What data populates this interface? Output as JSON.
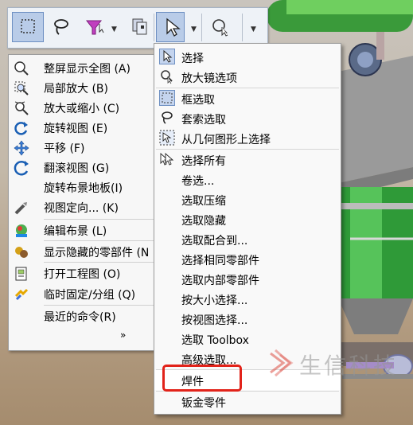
{
  "toolbar": {
    "buttons": [
      {
        "icon": "box-select-icon",
        "active": true
      },
      {
        "icon": "lasso-icon",
        "active": false
      },
      {
        "icon": "filter-select-icon",
        "active": false
      },
      {
        "icon": "select-other-icon",
        "active": false
      },
      {
        "icon": "select-arrow-icon",
        "active": true
      },
      {
        "icon": "magnifier-select-icon",
        "active": false
      }
    ]
  },
  "context_menu": {
    "items": [
      {
        "label": "整屏显示全图 (A)",
        "icon": "zoom-to-fit-icon"
      },
      {
        "label": "局部放大 (B)",
        "icon": "zoom-area-icon"
      },
      {
        "label": "放大或缩小 (C)",
        "icon": "zoom-in-out-icon"
      },
      {
        "label": "旋转视图 (E)",
        "icon": "rotate-view-icon"
      },
      {
        "label": "平移 (F)",
        "icon": "pan-icon"
      },
      {
        "label": "翻滚视图 (G)",
        "icon": "roll-view-icon"
      },
      {
        "label": "旋转布景地板(I)",
        "icon": ""
      },
      {
        "label": "视图定向... (K)",
        "icon": "view-orientation-icon"
      },
      {
        "label": "编辑布景 (L)",
        "icon": "edit-scene-icon"
      },
      {
        "label": "显示隐藏的零部件 (N",
        "icon": "show-hidden-components-icon"
      },
      {
        "label": "打开工程图 (O)",
        "icon": "open-drawing-icon"
      },
      {
        "label": "临时固定/分组 (Q)",
        "icon": "temp-fix-group-icon"
      },
      {
        "label": "最近的命令(R)",
        "icon": ""
      }
    ],
    "more": "»"
  },
  "submenu": {
    "items": [
      {
        "label": "选择",
        "icon": "select-arrow-icon"
      },
      {
        "label": "放大镜选项",
        "icon": "magnifier-select-icon"
      },
      {
        "label": "框选取",
        "icon": "box-select-icon"
      },
      {
        "label": "套索选取",
        "icon": "lasso-icon"
      },
      {
        "label": "从几何图形上选择",
        "icon": "select-over-geometry-icon"
      },
      {
        "label": "选择所有",
        "icon": "select-all-icon"
      },
      {
        "label": "卷选...",
        "icon": ""
      },
      {
        "label": "选取压缩",
        "icon": ""
      },
      {
        "label": "选取隐藏",
        "icon": ""
      },
      {
        "label": "选取配合到...",
        "icon": ""
      },
      {
        "label": "选择相同零部件",
        "icon": ""
      },
      {
        "label": "选取内部零部件",
        "icon": ""
      },
      {
        "label": "按大小选择...",
        "icon": ""
      },
      {
        "label": "按视图选择...",
        "icon": ""
      },
      {
        "label": "选取 Toolbox",
        "icon": ""
      },
      {
        "label": "高级选取...",
        "icon": ""
      },
      {
        "label": "焊件",
        "icon": ""
      },
      {
        "label": "钣金零件",
        "icon": ""
      }
    ]
  },
  "watermark": {
    "text": "生信科技"
  },
  "colors": {
    "highlight_box": "#e2231a",
    "active_button": "#b9cce8"
  }
}
